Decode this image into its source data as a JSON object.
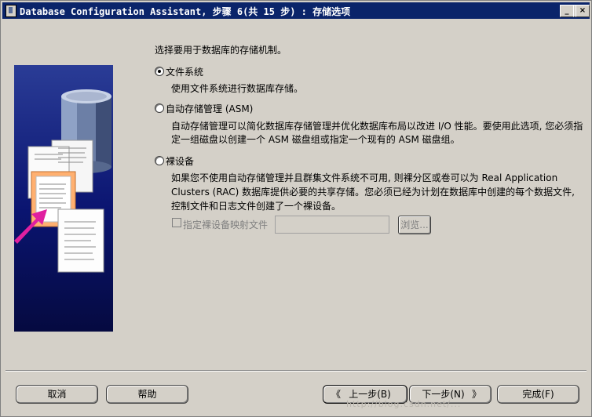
{
  "window": {
    "title": "Database Configuration Assistant, 步骤 6(共 15 步) : 存储选项",
    "controls": {
      "minimize": "_",
      "maximize": "□",
      "close": "×"
    }
  },
  "main": {
    "instruction": "选择要用于数据库的存储机制。",
    "options": [
      {
        "label": "文件系统",
        "selected": true,
        "description": [
          "使用文件系统进行数据库存储。"
        ]
      },
      {
        "label": "自动存储管理 (ASM)",
        "selected": false,
        "description": [
          "自动存储管理可以简化数据库存储管理并优化数据库布局以改进 I/O 性能。要使用此选项, 您必须指",
          "定一组磁盘以创建一个 ASM 磁盘组或指定一个现有的 ASM 磁盘组。"
        ]
      },
      {
        "label": "裸设备",
        "selected": false,
        "description": [
          "如果您不使用自动存储管理并且群集文件系统不可用, 则裸分区或卷可以为 Real Application",
          "Clusters (RAC) 数据库提供必要的共享存储。您必须已经为计划在数据库中创建的每个数据文件,",
          "控制文件和日志文件创建了一个裸设备。"
        ]
      }
    ],
    "raw_mapping": {
      "checkbox_label": "指定裸设备映射文件",
      "value": "",
      "browse_label": "浏览..."
    }
  },
  "footer": {
    "cancel": "取消",
    "help": "帮助",
    "back": "上一步(B)",
    "next": "下一步(N)",
    "finish": "完成(F)"
  },
  "watermark": "http://blog.csdn.net/...",
  "colors": {
    "titlebar": "#0a246a",
    "dialog": "#d4d0c8",
    "panel": "#0a1470",
    "arrow": "#e020a0"
  },
  "icons": [
    "database-cylinder-icon",
    "document-stack-icon",
    "arrow-icon",
    "back-arrow-icon",
    "forward-arrow-icon"
  ]
}
